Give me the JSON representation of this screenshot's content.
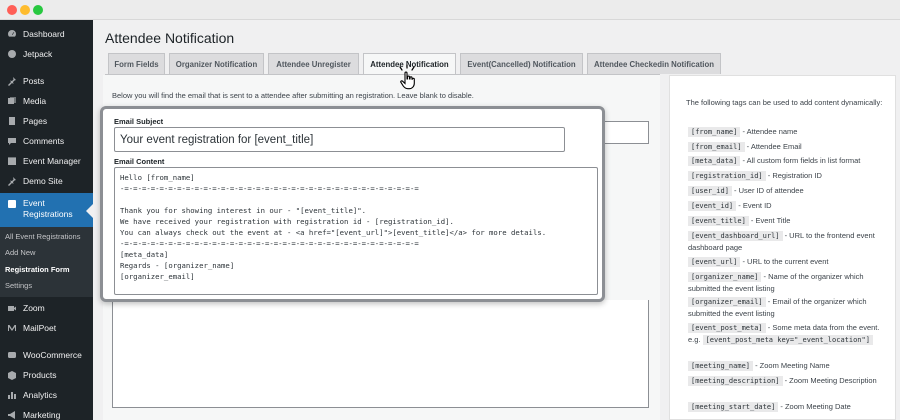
{
  "window": {
    "dots": {
      "close": "#ff5f57",
      "minimize": "#febc2e",
      "maximize": "#28c840"
    }
  },
  "sidebar": {
    "items": [
      {
        "label": "Dashboard",
        "icon": "dashboard-icon"
      },
      {
        "label": "Jetpack",
        "icon": "jetpack-icon"
      },
      {
        "label": "Posts",
        "icon": "pin-icon"
      },
      {
        "label": "Media",
        "icon": "media-icon"
      },
      {
        "label": "Pages",
        "icon": "pages-icon"
      },
      {
        "label": "Comments",
        "icon": "comments-icon"
      },
      {
        "label": "Event Manager",
        "icon": "calendar-icon"
      },
      {
        "label": "Demo Site",
        "icon": "pin-icon"
      },
      {
        "label": "Event",
        "label2": "Registrations",
        "icon": "event-registrations-icon"
      },
      {
        "label": "Zoom",
        "icon": "video-icon"
      },
      {
        "label": "MailPoet",
        "icon": "mailpoet-icon"
      },
      {
        "label": "WooCommerce",
        "icon": "woocommerce-icon"
      },
      {
        "label": "Products",
        "icon": "products-icon"
      },
      {
        "label": "Analytics",
        "icon": "analytics-icon"
      },
      {
        "label": "Marketing",
        "icon": "marketing-icon"
      }
    ],
    "submenu": [
      "All Event Registrations",
      "Add New",
      "Registration Form",
      "Settings"
    ],
    "active_color": "#2271b1"
  },
  "page": {
    "title": "Attendee Notification",
    "tabs": [
      "Form Fields",
      "Organizer Notification",
      "Attendee Unregister",
      "Attendee Notification",
      "Event(Cancelled) Notification",
      "Attendee Checkedin Notification"
    ],
    "active_tab": "Attendee Notification",
    "description": "Below you will find the email that is sent to a attendee after submitting an registration. Leave blank to disable."
  },
  "form": {
    "subject_label": "Email Subject",
    "subject_value": "Your event registration for [event_title]",
    "content_label": "Email Content",
    "content_lines": [
      "Hello [from_name]",
      "-=-=-=-=-=-=-=-=-=-=-=-=-=-=-=-=-=-=-=-=-=-=-=-=-=-=-=-=-=-=-=-=-=-=",
      "",
      "Thank you for showing interest in our - \"[event_title]\".",
      "We have received your registration with registration id - [registration_id].",
      "You can always check out the event at - <a href=\"[event_url]\">[event_title]</a> for more details.",
      "-=-=-=-=-=-=-=-=-=-=-=-=-=-=-=-=-=-=-=-=-=-=-=-=-=-=-=-=-=-=-=-=-=-=",
      "[meta_data]",
      "Regards - [organizer_name]",
      "[organizer_email]"
    ]
  },
  "tags": {
    "intro": "The following tags can be used to add content dynamically:",
    "entries": [
      {
        "code": "[from_name]",
        "desc": " - Attendee name"
      },
      {
        "code": "[from_email]",
        "desc": " - Attendee Email"
      },
      {
        "code": "[meta_data]",
        "desc": " - All custom form fields in list format"
      },
      {
        "code": "[registration_id]",
        "desc": " - Registration ID"
      },
      {
        "code": "[user_id]",
        "desc": " - User ID of attendee"
      },
      {
        "code": "[event_id]",
        "desc": " - Event ID"
      },
      {
        "code": "[event_title]",
        "desc": " - Event Title"
      },
      {
        "code": "[event_dashboard_url]",
        "desc": " - URL to the frontend event dashboard page"
      },
      {
        "code": "[event_url]",
        "desc": " - URL to the current event"
      },
      {
        "code": "[organizer_name]",
        "desc": " - Name of the organizer which submitted the event listing"
      },
      {
        "code": "[organizer_email]",
        "desc": " - Email of the organizer which submitted the event listing"
      },
      {
        "code": "[event_post_meta]",
        "desc": " - Some meta data from the event. e.g. ",
        "code2": "[event_post_meta key=\"_event_location\"]"
      },
      {
        "code": "[meeting_name]",
        "desc": " - Zoom Meeting Name"
      },
      {
        "code": "[meeting_description]",
        "desc": " - Zoom Meeting Description"
      },
      {
        "code": "[meeting_start_date]",
        "desc": " - Zoom Meeting Date"
      }
    ]
  }
}
